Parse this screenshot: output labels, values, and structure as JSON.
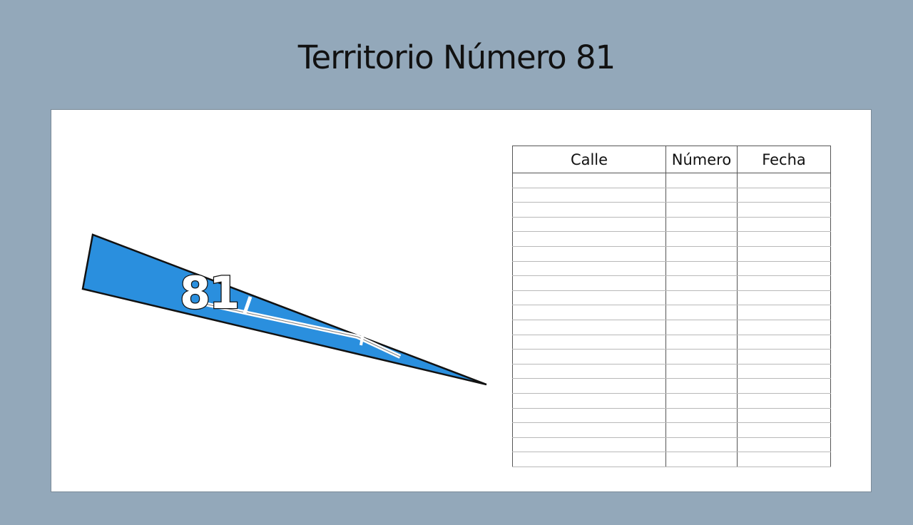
{
  "title": "Territorio Número 81",
  "map": {
    "territory_label": "81",
    "territory_color": "#2a8fde"
  },
  "table": {
    "headers": [
      "Calle",
      "Número",
      "Fecha"
    ],
    "row_count": 20
  }
}
